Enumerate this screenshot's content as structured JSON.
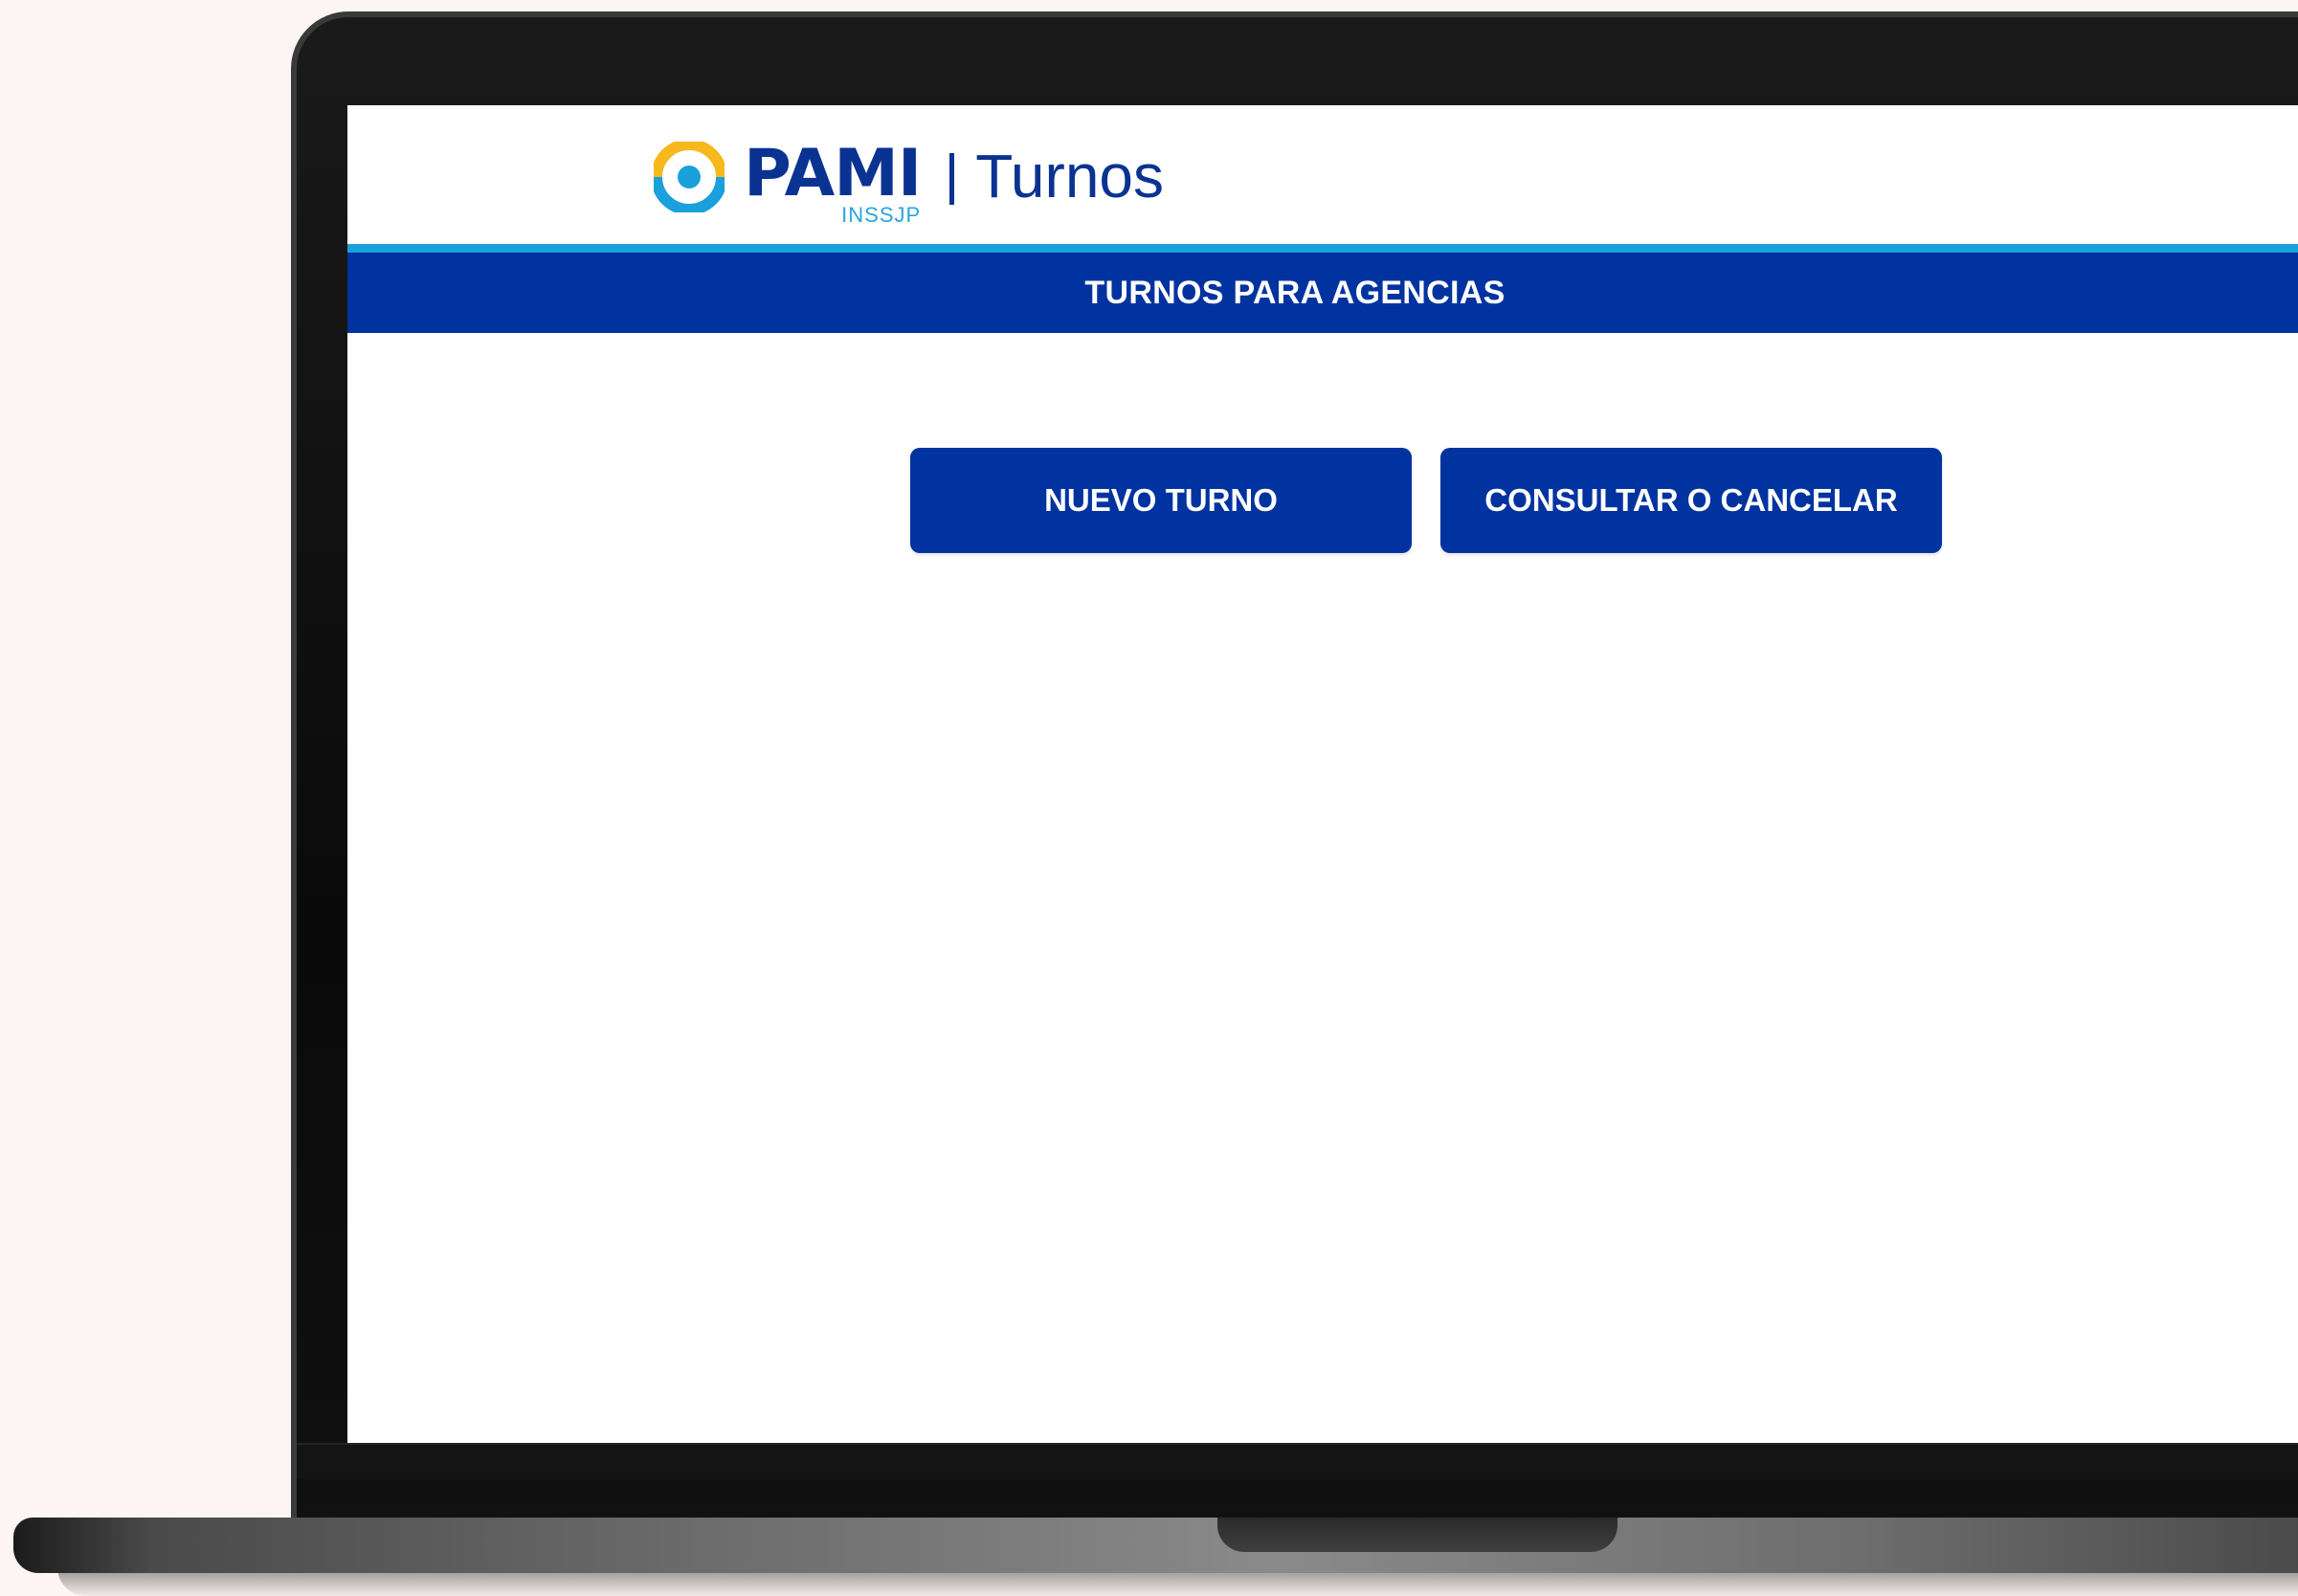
{
  "header": {
    "logo_text": "PAMI",
    "logo_subtext": "INSSJP",
    "app_name": "Turnos"
  },
  "title_bar": {
    "title": "TURNOS PARA AGENCIAS"
  },
  "actions": {
    "new_label": "NUEVO TURNO",
    "manage_label": "CONSULTAR O CANCELAR"
  },
  "colors": {
    "brand_blue": "#0033a0",
    "accent_cyan": "#1aa0db",
    "logo_yellow": "#f7b81c",
    "background": "#fdf5f3"
  },
  "icons": {
    "logo": "pami-ring-logo-icon"
  }
}
